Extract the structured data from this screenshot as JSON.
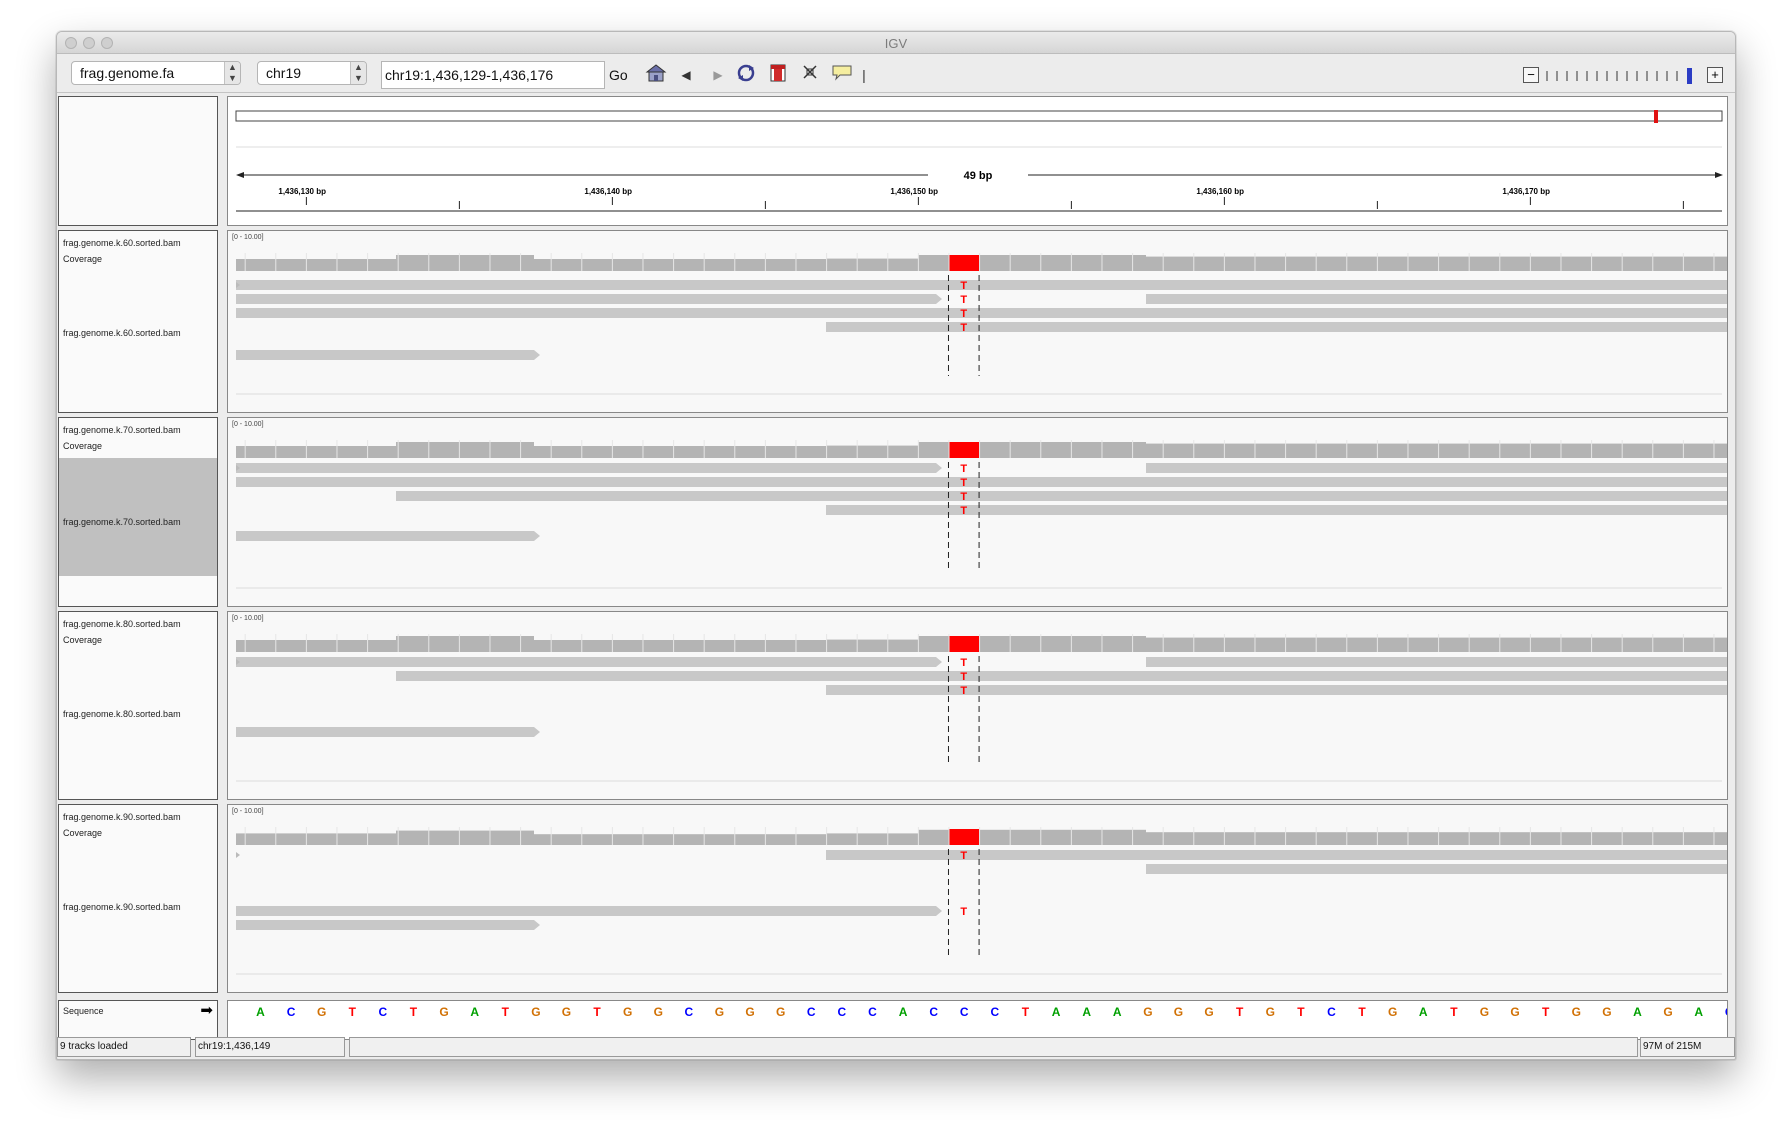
{
  "window": {
    "title": "IGV"
  },
  "toolbar": {
    "genome": "frag.genome.fa",
    "chromosome": "chr19",
    "locus": "chr19:1,436,129-1,436,176",
    "go_label": "Go",
    "icons": [
      "home-icon",
      "back-icon",
      "forward-icon",
      "refresh-icon",
      "roi-icon",
      "fit-icon",
      "popup-icon"
    ]
  },
  "ruler": {
    "span_label": "49 bp",
    "ticks": [
      "1,436,130 bp",
      "1,436,140 bp",
      "1,436,150 bp",
      "1,436,160 bp",
      "1,436,170 bp"
    ]
  },
  "panels": [
    {
      "coverage_name": "frag.genome.k.60.sorted.bam Coverage",
      "alignment_name": "frag.genome.k.60.sorted.bam",
      "range": "[0 - 10.00]",
      "selected": false
    },
    {
      "coverage_name": "frag.genome.k.70.sorted.bam Coverage",
      "alignment_name": "frag.genome.k.70.sorted.bam",
      "range": "[0 - 10.00]",
      "selected": true
    },
    {
      "coverage_name": "frag.genome.k.80.sorted.bam Coverage",
      "alignment_name": "frag.genome.k.80.sorted.bam",
      "range": "[0 - 10.00]",
      "selected": false
    },
    {
      "coverage_name": "frag.genome.k.90.sorted.bam Coverage",
      "alignment_name": "frag.genome.k.90.sorted.bam",
      "range": "[0 - 10.00]",
      "selected": false
    }
  ],
  "mismatch_base": "T",
  "sequence": {
    "label": "Sequence",
    "bases": [
      "A",
      "C",
      "G",
      "T",
      "C",
      "T",
      "G",
      "A",
      "T",
      "G",
      "G",
      "T",
      "G",
      "G",
      "C",
      "G",
      "G",
      "G",
      "C",
      "C",
      "C",
      "A",
      "C",
      "C",
      "C",
      "T",
      "A",
      "A",
      "A",
      "G",
      "G",
      "G",
      "T",
      "G",
      "T",
      "C",
      "T",
      "G",
      "A",
      "T",
      "G",
      "G",
      "T",
      "G",
      "G",
      "A",
      "G",
      "A",
      "C"
    ],
    "colors": {
      "A": "#00a000",
      "C": "#0000ff",
      "G": "#d17105",
      "T": "#ff0000"
    }
  },
  "status": {
    "tracks_loaded": "9 tracks loaded",
    "position": "chr19:1,436,149",
    "message": "",
    "memory": "97M of 215M"
  }
}
